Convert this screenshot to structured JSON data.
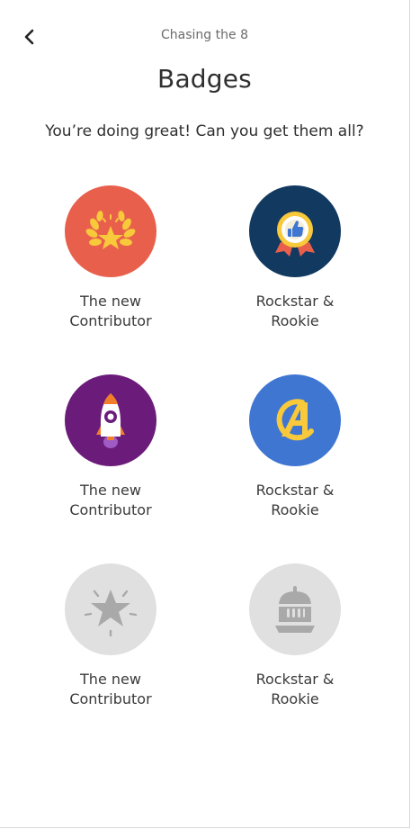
{
  "header": {
    "back_icon": "chevron-left-icon",
    "top_title": "Chasing the 8"
  },
  "page": {
    "title": "Badges",
    "subtitle": "You’re doing great! Can you get them all?"
  },
  "badges": [
    {
      "line1": "The new",
      "line2": "Contributor",
      "icon": "laurel-star-icon",
      "color": "#E8604C",
      "earned": true
    },
    {
      "line1": "Rockstar &",
      "line2": "Rookie",
      "icon": "thumbs-up-medal-icon",
      "color": "#12395F",
      "earned": true
    },
    {
      "line1": "The new",
      "line2": "Contributor",
      "icon": "rocket-icon",
      "color": "#6B1B7A",
      "earned": true
    },
    {
      "line1": "Rockstar &",
      "line2": "Rookie",
      "icon": "avengers-logo-icon",
      "color": "#3F76D2",
      "earned": true
    },
    {
      "line1": "The new",
      "line2": "Contributor",
      "icon": "star-burst-icon",
      "color": "#E0E0E0",
      "earned": false
    },
    {
      "line1": "Rockstar &",
      "line2": "Rookie",
      "icon": "knight-helmet-icon",
      "color": "#E0E0E0",
      "earned": false
    }
  ]
}
